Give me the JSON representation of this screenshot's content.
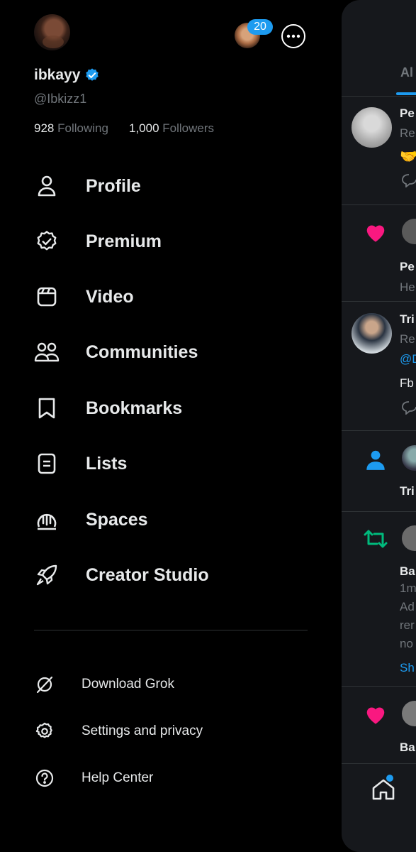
{
  "profile": {
    "display_name": "ibkayy",
    "handle": "@Ibkizz1",
    "following_count": "928",
    "following_label": "Following",
    "followers_count": "1,000",
    "followers_label": "Followers",
    "notification_badge": "20",
    "verified_color": "#1d9bf0"
  },
  "nav": {
    "items": [
      {
        "label": "Profile",
        "icon": "person-icon"
      },
      {
        "label": "Premium",
        "icon": "verified-badge-icon"
      },
      {
        "label": "Video",
        "icon": "video-icon"
      },
      {
        "label": "Communities",
        "icon": "communities-icon"
      },
      {
        "label": "Bookmarks",
        "icon": "bookmark-icon"
      },
      {
        "label": "Lists",
        "icon": "list-icon"
      },
      {
        "label": "Spaces",
        "icon": "spaces-icon"
      },
      {
        "label": "Creator Studio",
        "icon": "rocket-icon"
      }
    ]
  },
  "secondary": {
    "items": [
      {
        "label": "Download Grok",
        "icon": "grok-icon"
      },
      {
        "label": "Settings and privacy",
        "icon": "gear-icon"
      },
      {
        "label": "Help Center",
        "icon": "help-icon"
      }
    ]
  },
  "feed": {
    "tab_label": "Al",
    "rows": [
      {
        "title": "Pe",
        "line2": "Re"
      },
      {
        "title": "Pe",
        "line2": "He"
      },
      {
        "title": "Tri",
        "line2": "Re",
        "mention": "@D",
        "line3": "Fb"
      },
      {
        "title": "Tri"
      },
      {
        "title": "Ba",
        "line2": "1m",
        "line3": "Ad",
        "line4": "rer",
        "line5": "no",
        "link": "Sh"
      },
      {
        "title": "Ba"
      }
    ],
    "colors": {
      "accent": "#1d9bf0",
      "like": "#f91880",
      "retweet": "#00ba7c"
    }
  }
}
